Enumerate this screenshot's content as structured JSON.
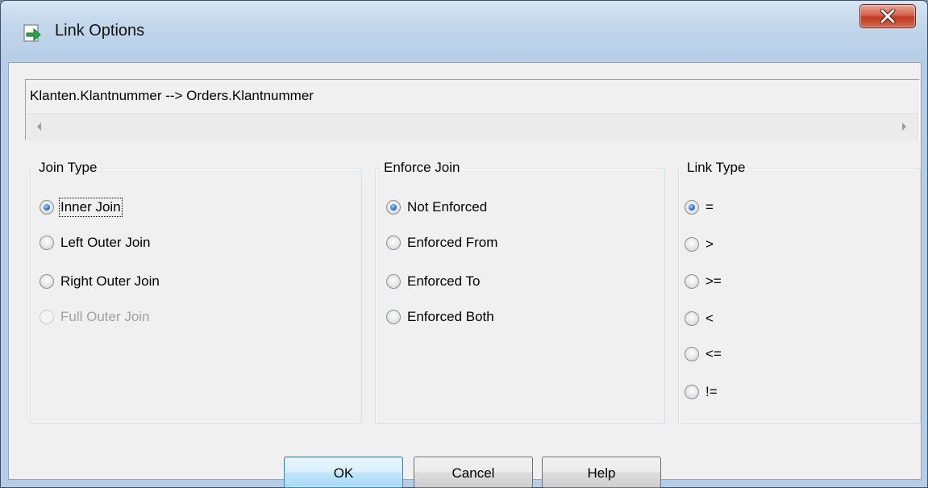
{
  "window": {
    "title": "Link Options",
    "close_label": "X"
  },
  "expression": {
    "text": "Klanten.Klantnummer --> Orders.Klantnummer"
  },
  "join_type": {
    "legend": "Join Type",
    "options": [
      {
        "label": "Inner Join",
        "selected": true,
        "enabled": true,
        "focused": true,
        "mnemonic": "I"
      },
      {
        "label": "Left Outer Join",
        "selected": false,
        "enabled": true,
        "mnemonic": "t"
      },
      {
        "label": "Right Outer Join",
        "selected": false,
        "enabled": true,
        "mnemonic": "g"
      },
      {
        "label": "Full Outer Join",
        "selected": false,
        "enabled": false,
        "mnemonic": "l"
      }
    ]
  },
  "enforce_join": {
    "legend": "Enforce Join",
    "options": [
      {
        "label": "Not Enforced",
        "selected": true,
        "mnemonic": "c"
      },
      {
        "label": "Enforced From",
        "selected": false,
        "mnemonic": "F"
      },
      {
        "label": "Enforced To",
        "selected": false,
        "mnemonic": "n"
      },
      {
        "label": "Enforced Both",
        "selected": false,
        "mnemonic": "E"
      }
    ]
  },
  "link_type": {
    "legend": "Link Type",
    "options": [
      {
        "label": "=",
        "selected": true
      },
      {
        "label": ">",
        "selected": false
      },
      {
        "label": ">=",
        "selected": false
      },
      {
        "label": "<",
        "selected": false
      },
      {
        "label": "<=",
        "selected": false
      },
      {
        "label": "!=",
        "selected": false
      }
    ]
  },
  "buttons": {
    "ok": "OK",
    "cancel": "Cancel",
    "help": "Help"
  },
  "colors": {
    "radio_selected": "#2a7ad0",
    "default_button_border": "#3c7fb1",
    "close_button": "#c23b21",
    "disabled_text": "#a0a0a0"
  }
}
